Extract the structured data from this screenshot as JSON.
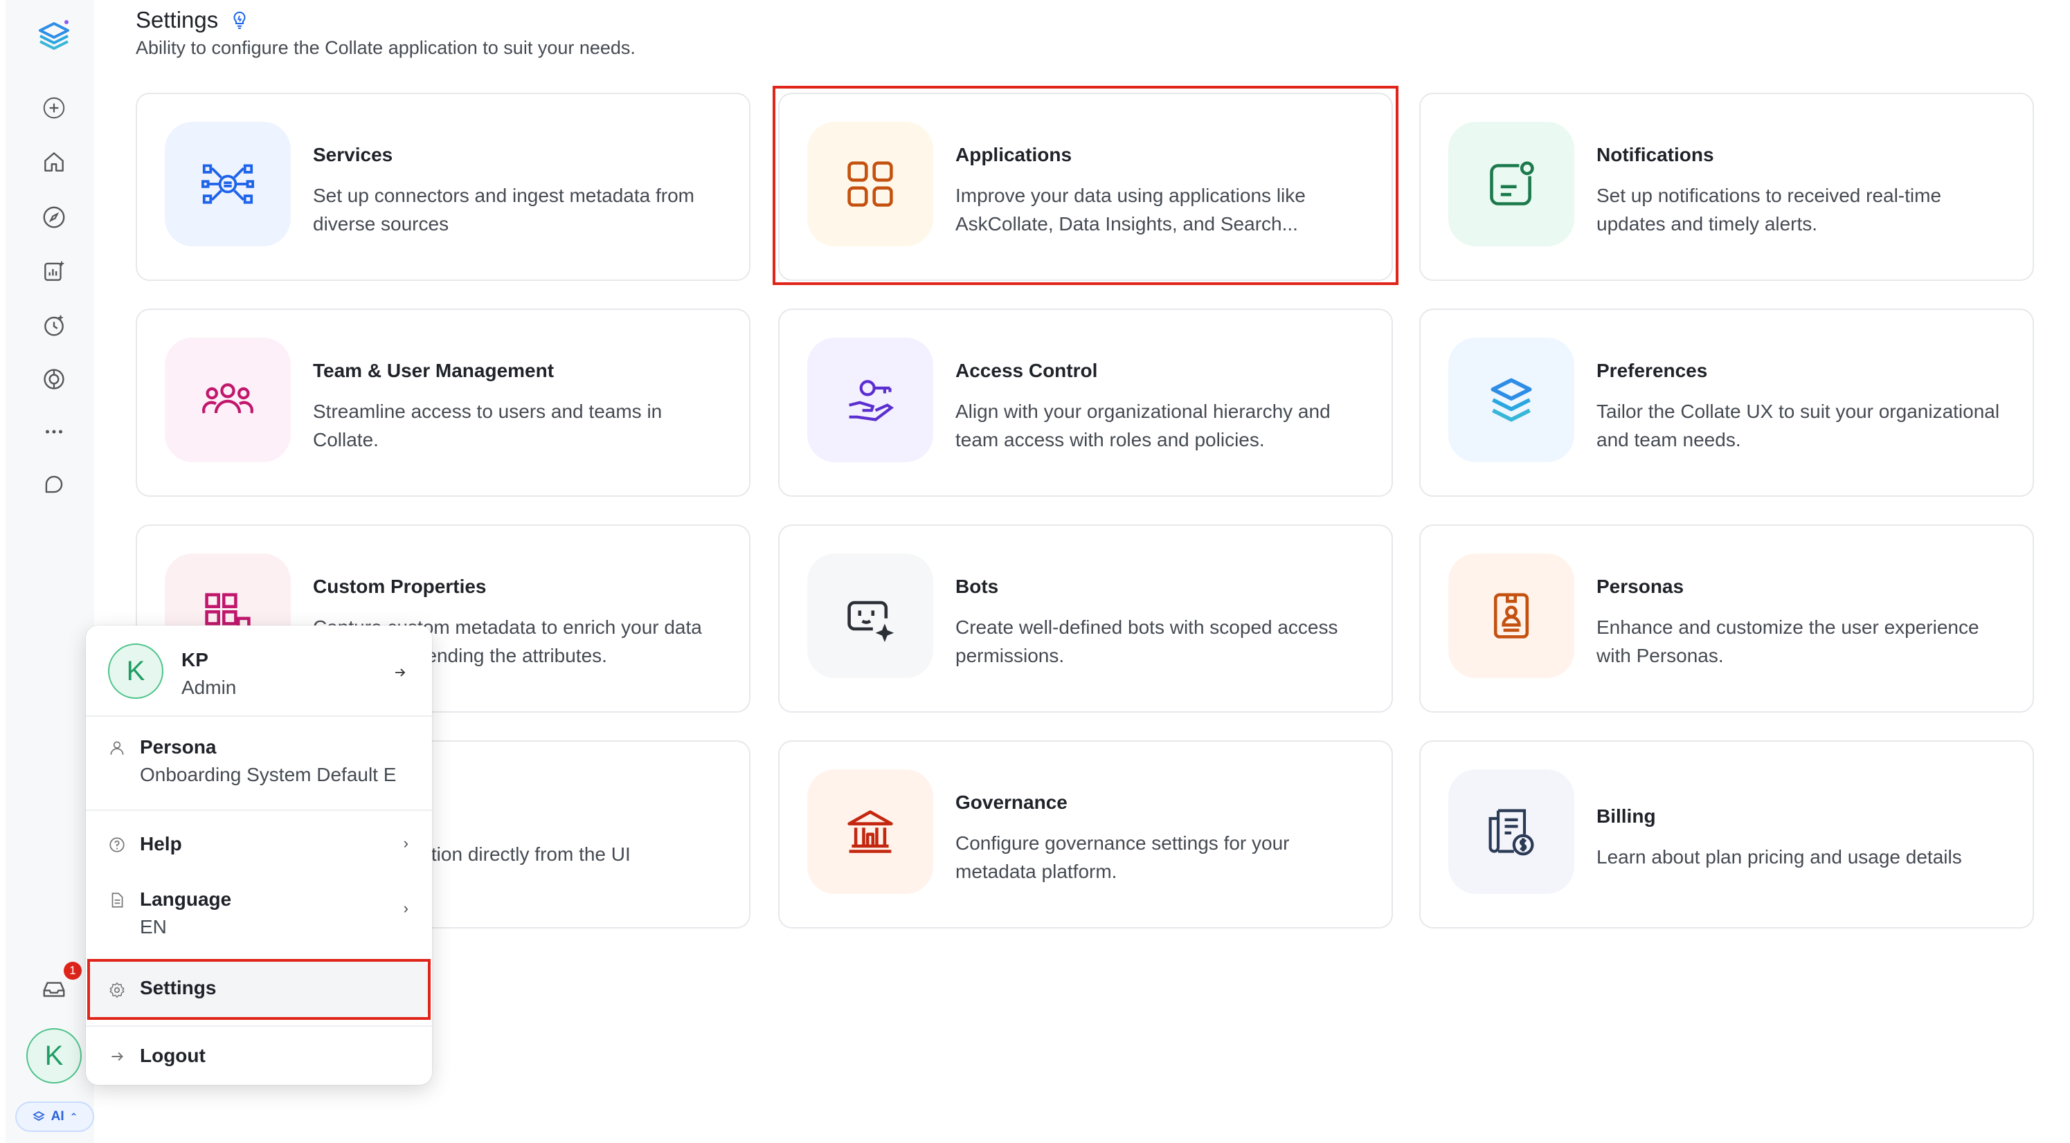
{
  "header": {
    "title": "Settings",
    "subtitle": "Ability to configure the Collate application to suit your needs."
  },
  "cards": [
    {
      "title": "Services",
      "description": "Set up connectors and ingest metadata from diverse sources",
      "icon": "services-network-icon",
      "color": "#1e63e9",
      "bg": "#eef4ff"
    },
    {
      "title": "Applications",
      "description": "Improve your data using applications like AskCollate, Data Insights, and Search...",
      "icon": "applications-grid-icon",
      "color": "#c4510f",
      "bg": "#fff8ea"
    },
    {
      "title": "Notifications",
      "description": "Set up notifications to received real-time updates and timely alerts.",
      "icon": "notification-message-icon",
      "color": "#1b7a4c",
      "bg": "#eaf9f1"
    },
    {
      "title": "Team & User Management",
      "description": "Streamline access to users and teams in Collate.",
      "icon": "team-users-icon",
      "color": "#c0176d",
      "bg": "#fdf0f8"
    },
    {
      "title": "Access Control",
      "description": "Align with your organizational hierarchy and team access with roles and policies.",
      "icon": "key-hand-icon",
      "color": "#5b2ecf",
      "bg": "#f3f0ff"
    },
    {
      "title": "Preferences",
      "description": "Tailor the Collate UX to suit your organizational and team needs.",
      "icon": "collate-layers-icon",
      "color": "#1a9be0",
      "bg": "#eef6ff"
    },
    {
      "title": "Custom Properties",
      "description": "Capture custom metadata to enrich your data assets by extending the attributes.",
      "icon": "custom-properties-icon",
      "color": "#c0176d",
      "bg": "#fdf0f3"
    },
    {
      "title": "Bots",
      "description": "Create well-defined bots with scoped access permissions.",
      "icon": "bot-icon",
      "color": "#2b2f36",
      "bg": "#f6f7f8"
    },
    {
      "title": "Personas",
      "description": "Enhance and customize the user experience with Personas.",
      "icon": "persona-badge-icon",
      "color": "#c4510f",
      "bg": "#fff3ec"
    },
    {
      "title": "",
      "description": "ration directly from the UI",
      "icon": "",
      "color": "#2b2f36",
      "bg": "#ffffff"
    },
    {
      "title": "Governance",
      "description": "Configure governance settings for your metadata platform.",
      "icon": "bank-building-icon",
      "color": "#c4270f",
      "bg": "#fff3ec"
    },
    {
      "title": "Billing",
      "description": "Learn about plan pricing and usage details",
      "icon": "billing-invoice-icon",
      "color": "#2b3a55",
      "bg": "#f4f5fb"
    }
  ],
  "user_menu": {
    "avatar_initial": "K",
    "name": "KP",
    "role": "Admin",
    "persona_label": "Persona",
    "persona_value": "Onboarding System Default E",
    "help_label": "Help",
    "language_label": "Language",
    "language_value": "EN",
    "settings_label": "Settings",
    "logout_label": "Logout"
  },
  "sidebar": {
    "notification_count": "1",
    "avatar_initial": "K",
    "ai_label": "AI",
    "items": [
      "add-icon",
      "home-icon",
      "explore-compass-icon",
      "insights-chart-icon",
      "observability-clock-icon",
      "governance-icon",
      "more-dots-icon",
      "chat-icon",
      "inbox-icon"
    ]
  },
  "colors": {
    "highlight": "#e0251b",
    "accent": "#1e63e9"
  }
}
